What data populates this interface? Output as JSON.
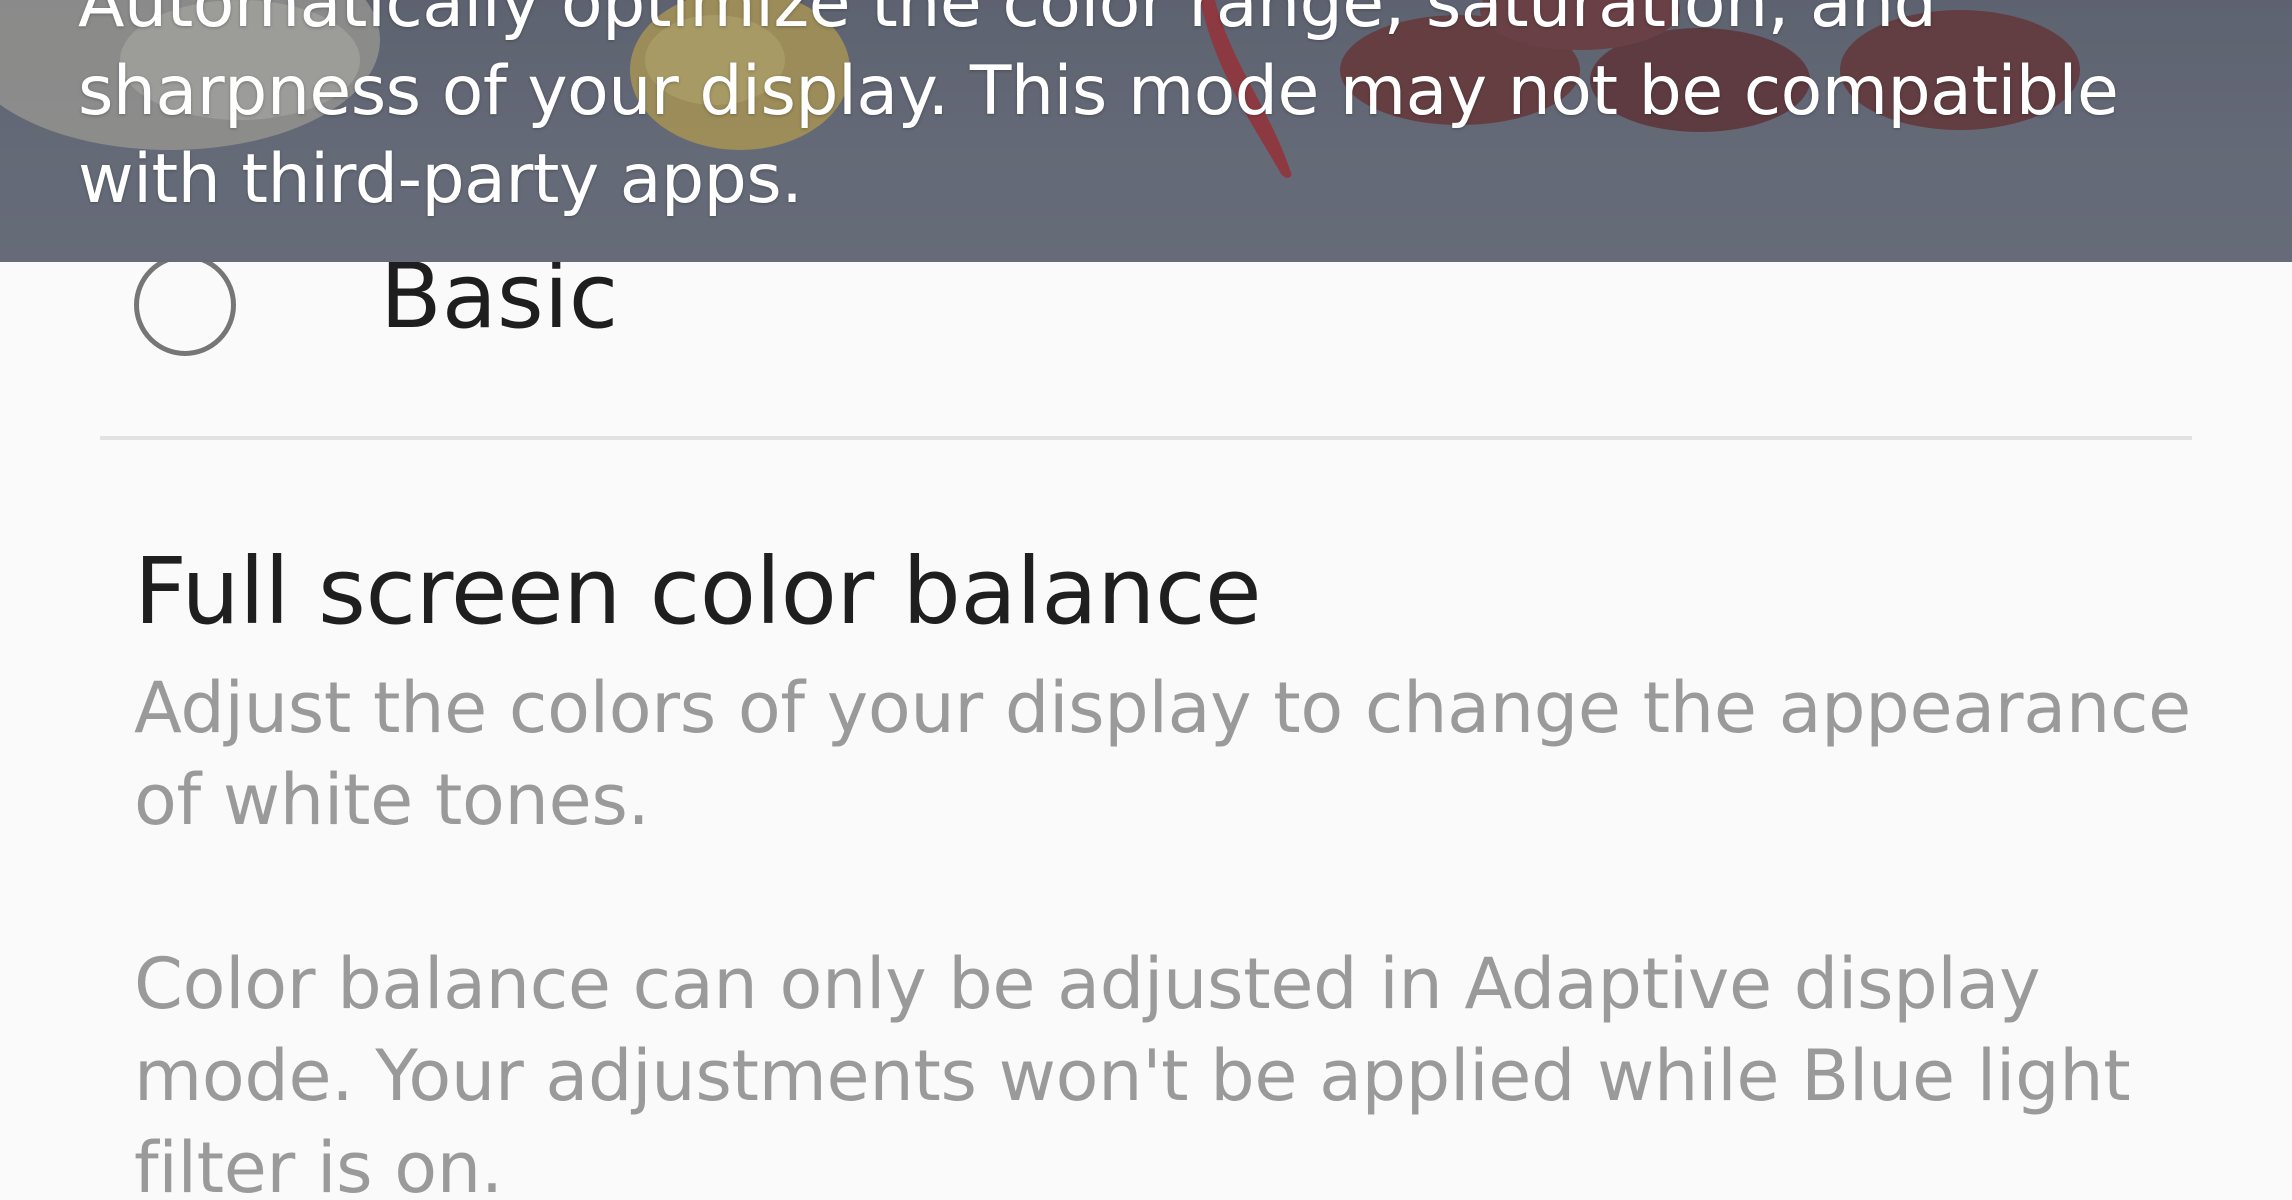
{
  "banner": {
    "description_partial": "Automatically optimize the color range, saturation, and sharpness of your display. This mode may not be compatible with third-party apps."
  },
  "screen_mode_option": {
    "label": "Basic",
    "selected": false
  },
  "color_balance": {
    "title": "Full screen color balance",
    "description": "Adjust the colors of your display to change the appearance of white tones.",
    "note": "Color balance can only be adjusted in Adaptive display mode. Your adjustments won't be applied while Blue light filter is on."
  },
  "colors": {
    "banner_bg": "#656a78",
    "page_bg": "#fafafa",
    "title_text": "#1f1f1f",
    "secondary_text": "#9a9a9a",
    "radio_border": "#767676",
    "divider": "#e2e2e2"
  }
}
